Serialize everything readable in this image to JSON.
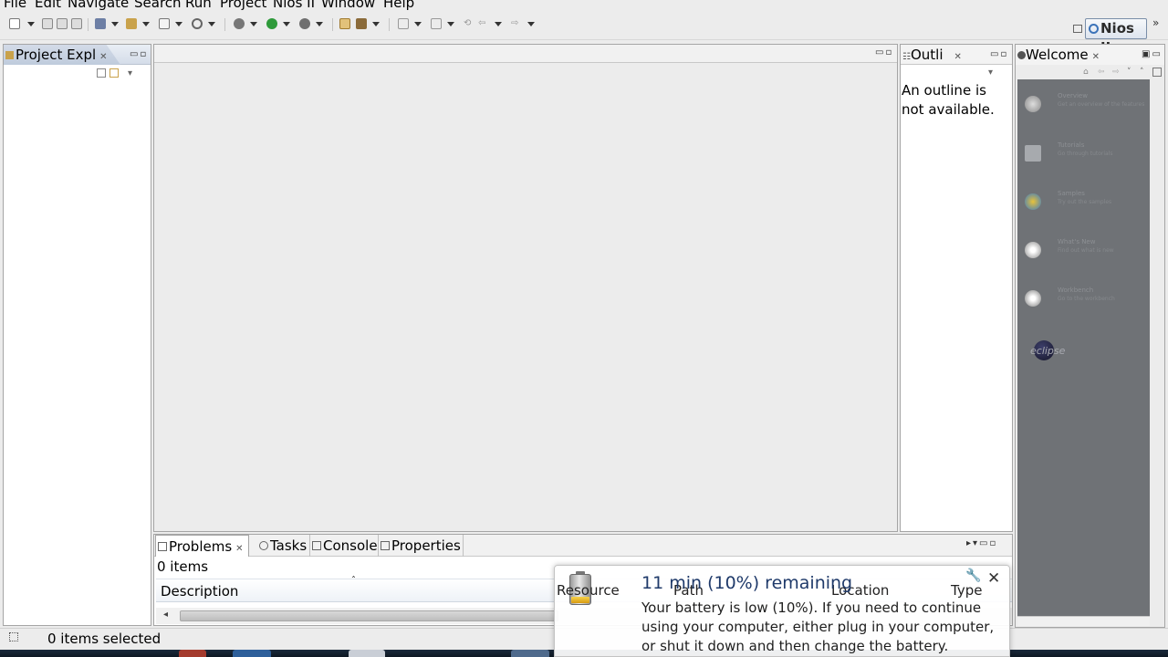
{
  "menu": [
    "File",
    "Edit",
    "Navigate",
    "Search",
    "Run",
    "Project",
    "Nios II",
    "Window",
    "Help"
  ],
  "perspective": {
    "label": "Nios II"
  },
  "project_explorer": {
    "tab_label": "Project Expl"
  },
  "outline": {
    "tab_label": "Outli",
    "message": "An outline is not available."
  },
  "welcome": {
    "tab_label": "Welcome",
    "items": [
      {
        "icon": "overview-icon",
        "title": "Overview",
        "desc": "Get an overview of the features"
      },
      {
        "icon": "tutorials-icon",
        "title": "Tutorials",
        "desc": "Go through tutorials"
      },
      {
        "icon": "samples-icon",
        "title": "Samples",
        "desc": "Try out the samples"
      },
      {
        "icon": "whats-new-icon",
        "title": "What's New",
        "desc": "Find out what is new"
      },
      {
        "icon": "workbench-icon",
        "title": "Workbench",
        "desc": "Go to the workbench"
      }
    ],
    "logo_text": "eclipse"
  },
  "problems": {
    "tabs": [
      {
        "label": "Problems",
        "icon": "problems-icon"
      },
      {
        "label": "Tasks",
        "icon": "tasks-icon"
      },
      {
        "label": "Console",
        "icon": "console-icon"
      },
      {
        "label": "Properties",
        "icon": "properties-icon"
      }
    ],
    "count": "0 items",
    "columns": [
      "Description",
      "Resource",
      "Path",
      "Location",
      "Type"
    ]
  },
  "status": {
    "text": "0 items selected"
  },
  "notification": {
    "title": "11 min (10%) remaining",
    "body": "Your battery is low (10%). If you need to continue using your computer, either plug in your computer, or shut it down and then change the battery."
  }
}
